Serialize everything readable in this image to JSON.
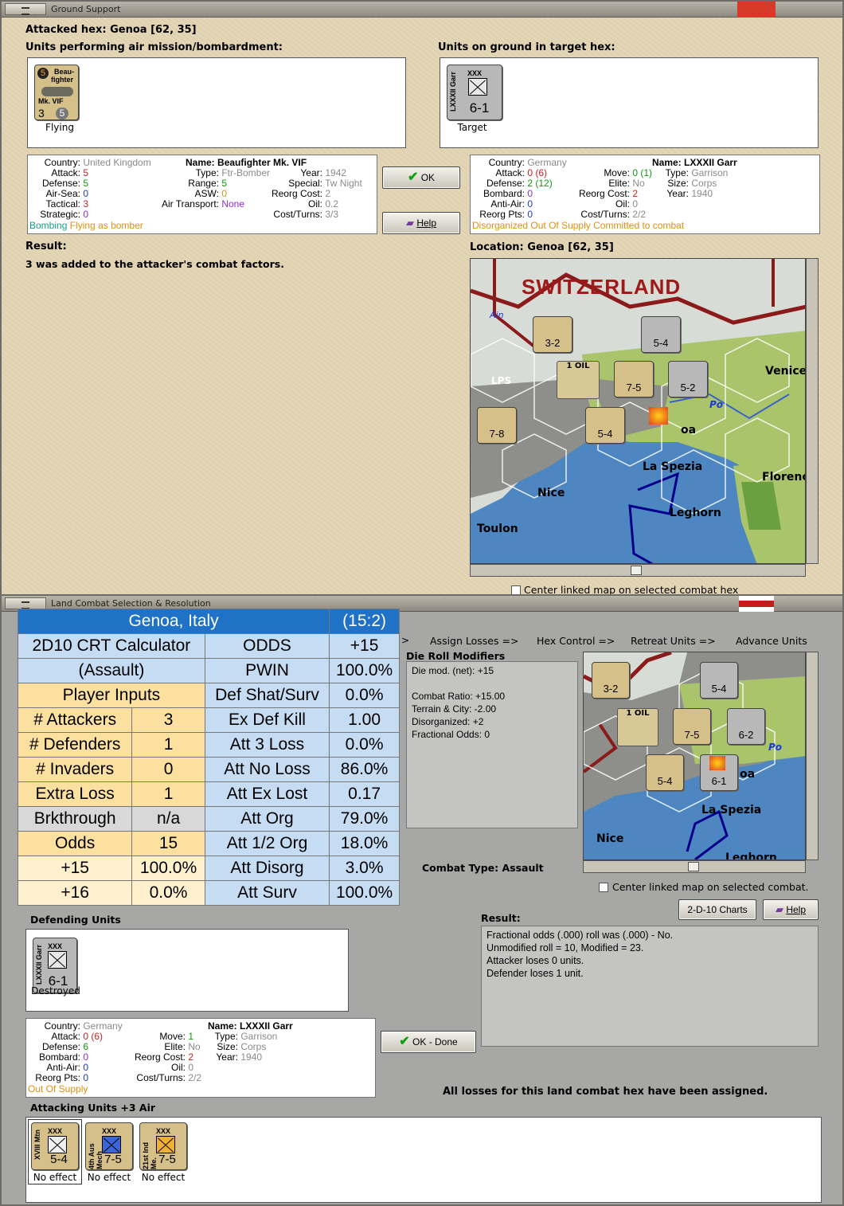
{
  "top": {
    "title": "Ground Support",
    "attacked_hex": "Attacked hex: Genoa  [62, 35]",
    "attackers_label": "Units performing air mission/bombardment:",
    "ground_label": "Units on ground in target hex:",
    "air_unit": {
      "badge": "5",
      "name1": "Beau-",
      "name2": "fighter",
      "name3": "Mk. VIF",
      "left_val": "3",
      "right_val": "5",
      "status": "Flying"
    },
    "ground_unit": {
      "side": "LXXXII Garr",
      "size": "XXX",
      "value": "6-1",
      "status": "Target"
    },
    "ok": "OK",
    "help": "Help",
    "result_label": "Result:",
    "result_text": "3 was added to the attacker's combat factors.",
    "location": "Location:  Genoa  [62, 35]",
    "center_linked": "Center linked map on selected combat hex",
    "air_info": {
      "country_k": "Country:",
      "country_v": "United Kingdom",
      "attack_k": "Attack:",
      "attack_v": "5",
      "defense_k": "Defense:",
      "defense_v": "5",
      "airsea_k": "Air-Sea:",
      "airsea_v": "0",
      "tactical_k": "Tactical:",
      "tactical_v": "3",
      "strategic_k": "Strategic:",
      "strategic_v": "0",
      "bombing": "Bombing",
      "flying": "Flying as bomber",
      "name_k": "Name:",
      "name_v": "Beaufighter Mk. VIF",
      "type_k": "Type:",
      "type_v": "Ftr-Bomber",
      "year_k": "Year:",
      "year_v": "1942",
      "range_k": "Range:",
      "range_v": "5",
      "special_k": "Special:",
      "special_v": "Tw Night",
      "asw_k": "ASW:",
      "asw_v": "0",
      "reorg_k": "Reorg Cost:",
      "reorg_v": "2",
      "airt_k": "Air Transport:",
      "airt_v": "None",
      "oil_k": "Oil:",
      "oil_v": "0.2",
      "cost_k": "Cost/Turns:",
      "cost_v": "3/3"
    },
    "ground_info": {
      "country_k": "Country:",
      "country_v": "Germany",
      "attack_k": "Attack:",
      "attack_v": "0 (6)",
      "defense_k": "Defense:",
      "defense_v": "2 (12)",
      "bombard_k": "Bombard:",
      "bombard_v": "0",
      "antiair_k": "Anti-Air:",
      "antiair_v": "0",
      "reorgpts_k": "Reorg Pts:",
      "reorgpts_v": "0",
      "status1": "Disorganized",
      "status2": "Out Of Supply",
      "status3": "Committed to combat",
      "name_k": "Name:",
      "name_v": "LXXXII Garr",
      "move_k": "Move:",
      "move_v": "0 (1)",
      "type_k": "Type:",
      "type_v": "Garrison",
      "elite_k": "Elite:",
      "elite_v": "No",
      "size_k": "Size:",
      "size_v": "Corps",
      "reorg_k": "Reorg Cost:",
      "reorg_v": "2",
      "year_k": "Year:",
      "year_v": "1940",
      "oil_k": "Oil:",
      "oil_v": "0",
      "cost_k": "Cost/Turns:",
      "cost_v": "2/2"
    },
    "map_labels": {
      "switzerland": "SWITZERLAND",
      "venice": "Venice",
      "po": "Po",
      "la_spezia": "La Spezia",
      "nice": "Nice",
      "florence": "Florenc",
      "leghorn": "Leghorn",
      "toulon": "Toulon",
      "lps": "LPS",
      "oa": "oa",
      "ain": "Ain",
      "oil": "1 OIL"
    },
    "map_counters": [
      {
        "label": "3-2"
      },
      {
        "label": "5-4"
      },
      {
        "label": "7-5"
      },
      {
        "label": "5-2"
      },
      {
        "label": "7-8"
      },
      {
        "label": "5-4"
      }
    ]
  },
  "bottom": {
    "title": "Land Combat Selection & Resolution",
    "crt": {
      "r0": [
        "Genoa, Italy",
        "(15:2)"
      ],
      "r1": [
        "2D10 CRT Calculator",
        "ODDS",
        "+15"
      ],
      "r2": [
        "(Assault)",
        "PWIN",
        "100.0%"
      ],
      "r3": [
        "Player Inputs",
        "Def Shat/Surv",
        "0.0%"
      ],
      "r4": [
        "# Attackers",
        "3",
        "Ex Def Kill",
        "1.00"
      ],
      "r5": [
        "# Defenders",
        "1",
        "Att 3 Loss",
        "0.0%"
      ],
      "r6": [
        "# Invaders",
        "0",
        "Att No Loss",
        "86.0%"
      ],
      "r7": [
        "Extra Loss",
        "1",
        "Att Ex Lost",
        "0.17"
      ],
      "r8": [
        "Brkthrough",
        "n/a",
        "Att Org",
        "79.0%"
      ],
      "r9": [
        "Odds",
        "15",
        "Att 1/2 Org",
        "18.0%"
      ],
      "r10": [
        "+15",
        "100.0%",
        "Att Disorg",
        "3.0%"
      ],
      "r11": [
        "+16",
        "0.0%",
        "Att Surv",
        "100.0%"
      ]
    },
    "steps": {
      "s1": "Assign Losses =>",
      "s2": "Hex Control =>",
      "s3": "Retreat Units =>",
      "s4": "Advance Units"
    },
    "die_label": "Die Roll Modifiers",
    "die_lines": [
      "Die mod. (net): +15",
      "",
      "Combat Ratio: +15.00",
      "Terrain & City: -2.00",
      "Disorganized: +2",
      "Fractional Odds: 0"
    ],
    "combat_type": "Combat Type:  Assault",
    "center_linked": "Center linked map on selected combat.",
    "charts_btn": "2-D-10 Charts",
    "help": "Help",
    "defending_label": "Defending Units",
    "def_unit": {
      "side": "LXXXII Garr",
      "size": "XXX",
      "value": "6-1",
      "status": "Destroyed"
    },
    "result_label": "Result:",
    "result_lines": [
      "Fractional odds (.000) roll was (.000)  - No.",
      "Unmodified roll = 10, Modified = 23.",
      "Attacker loses 0 units.",
      "Defender loses 1 unit."
    ],
    "ok_done": "OK - Done",
    "all_losses": "All losses for this land combat hex have been assigned.",
    "def_info": {
      "country_k": "Country:",
      "country_v": "Germany",
      "attack_k": "Attack:",
      "attack_v": "0 (6)",
      "defense_k": "Defense:",
      "defense_v": "6",
      "bombard_k": "Bombard:",
      "bombard_v": "0",
      "antiair_k": "Anti-Air:",
      "antiair_v": "0",
      "reorgpts_k": "Reorg Pts:",
      "reorgpts_v": "0",
      "status": "Out Of Supply",
      "move_k": "Move:",
      "move_v": "1",
      "elite_k": "Elite:",
      "elite_v": "No",
      "reorg_k": "Reorg Cost:",
      "reorg_v": "2",
      "oil_k": "Oil:",
      "oil_v": "0",
      "cost_k": "Cost/Turns:",
      "cost_v": "2/2",
      "name_k": "Name:",
      "name_v": "LXXXII Garr",
      "type_k": "Type:",
      "type_v": "Garrison",
      "size_k": "Size:",
      "size_v": "Corps",
      "year_k": "Year:",
      "year_v": "1940"
    },
    "attacking_label": "Attacking Units +3 Air",
    "attackers": [
      {
        "side": "XVIII Mtn",
        "size": "XXX",
        "value": "5-4",
        "status": "No effect"
      },
      {
        "side": "4th Aus Mech",
        "size": "XXX",
        "value": "7-5",
        "status": "No effect"
      },
      {
        "side": "21st Ind Me.",
        "size": "XXX",
        "value": "7-5",
        "status": "No effect"
      }
    ],
    "map_labels": {
      "po": "Po",
      "la_spezia": "La Spezia",
      "nice": "Nice",
      "leghorn": "Leghorn",
      "oa": "oa",
      "oil": "1 OIL"
    },
    "map_counters": [
      {
        "label": "3-2"
      },
      {
        "label": "5-4"
      },
      {
        "label": "7-5"
      },
      {
        "label": "6-2"
      },
      {
        "label": "5-4"
      },
      {
        "label": "6-1"
      }
    ]
  },
  "colors": {
    "crt_header": "#1f72c6",
    "crt_blue": "#c6dcf2",
    "crt_yellow": "#fce0a0",
    "parchment": "#e2d4b4"
  }
}
